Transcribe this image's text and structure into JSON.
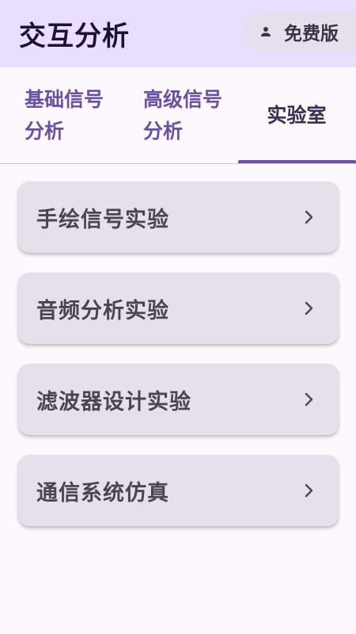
{
  "header": {
    "title": "交互分析",
    "plan_chip": {
      "icon": "person-icon",
      "label": "免费版"
    }
  },
  "tabs": [
    {
      "label": "基础信号分析",
      "active": false
    },
    {
      "label": "高级信号分析",
      "active": false
    },
    {
      "label": "实验室",
      "active": true
    }
  ],
  "lab_items": [
    {
      "label": "手绘信号实验",
      "icon": "chevron-right-icon"
    },
    {
      "label": "音频分析实验",
      "icon": "chevron-right-icon"
    },
    {
      "label": "滤波器设计实验",
      "icon": "chevron-right-icon"
    },
    {
      "label": "通信系统仿真",
      "icon": "chevron-right-icon"
    }
  ],
  "colors": {
    "header_bg": "#e9dffc",
    "accent": "#6b4fa8",
    "card_bg": "#e5e0e9",
    "page_bg": "#fdf8fd"
  }
}
